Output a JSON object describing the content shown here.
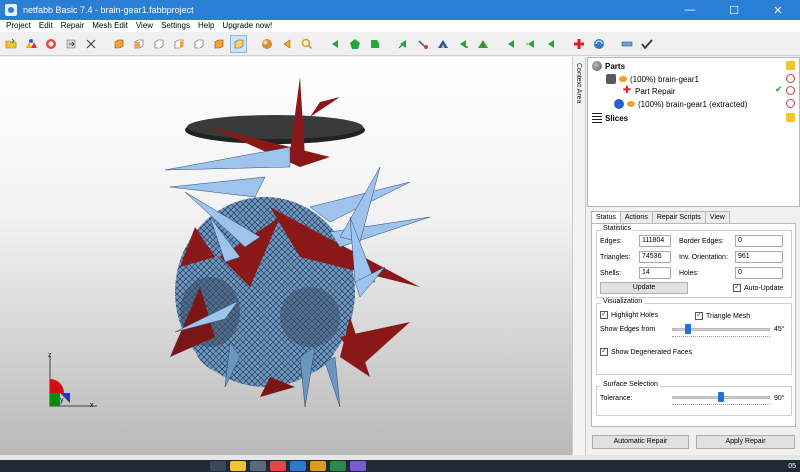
{
  "window": {
    "title": "netfabb Basic 7.4 - brain-gear1.fabbproject",
    "minimize": "—",
    "maximize": "☐",
    "close": "✕"
  },
  "menu": [
    "Project",
    "Edit",
    "Repair",
    "Mesh Edit",
    "View",
    "Settings",
    "Help",
    "Upgrade now!"
  ],
  "toolbar_icons": [
    "open-icon",
    "parts-icon",
    "repair-icon",
    "import-icon",
    "cut-icon",
    "view-front-icon",
    "view-back-icon",
    "view-left-icon",
    "view-right-icon",
    "view-top-icon",
    "view-bottom-icon",
    "view-perspective-icon",
    "shade-icon",
    "arrow-icon",
    "zoom-icon",
    "move-left-icon",
    "move-up-icon",
    "move-right-icon",
    "select-triangle-icon",
    "select-surface-icon",
    "select-shell-icon",
    "select-all-icon",
    "select-invert-icon",
    "green-left-icon",
    "green-right-icon",
    "green-up-icon",
    "add-repair-icon",
    "measure-icon",
    "ruler-icon",
    "check-icon"
  ],
  "context_area_label": "Context Area",
  "tree": {
    "parts_label": "Parts",
    "part1_label": "(100%) brain-gear1",
    "repair_label": "Part Repair",
    "part2_label": "(100%) brain-gear1 (extracted)",
    "slices_label": "Slices"
  },
  "tabs": [
    "Status",
    "Actions",
    "Repair Scripts",
    "View"
  ],
  "statistics": {
    "title": "Statistics",
    "edges_label": "Edges:",
    "edges": "111804",
    "border_edges_label": "Border Edges:",
    "border_edges": "0",
    "triangles_label": "Triangles:",
    "triangles": "74536",
    "inv_orientation_label": "Inv. Orientation:",
    "inv_orientation": "961",
    "shells_label": "Shells:",
    "shells": "14",
    "holes_label": "Holes:",
    "holes": "0",
    "update_label": "Update",
    "auto_update_label": "Auto-Update"
  },
  "visualization": {
    "title": "Visualization",
    "highlight_holes_label": "Highlight Holes",
    "triangle_mesh_label": "Triangle Mesh",
    "show_edges_label": "Show Edges from",
    "show_edges_value": "45°",
    "show_edges_fraction": 0.14,
    "show_degenerated_label": "Show Degenerated Faces"
  },
  "surface": {
    "title": "Surface Selection",
    "tolerance_label": "Tolerance:",
    "tolerance_value": "90°",
    "tolerance_fraction": 0.5
  },
  "buttons": {
    "automatic_repair": "Automatic Repair",
    "apply_repair": "Apply Repair"
  },
  "axes": {
    "x": "x",
    "y": "y",
    "z": "z"
  },
  "taskbar": {
    "clock": "05"
  }
}
